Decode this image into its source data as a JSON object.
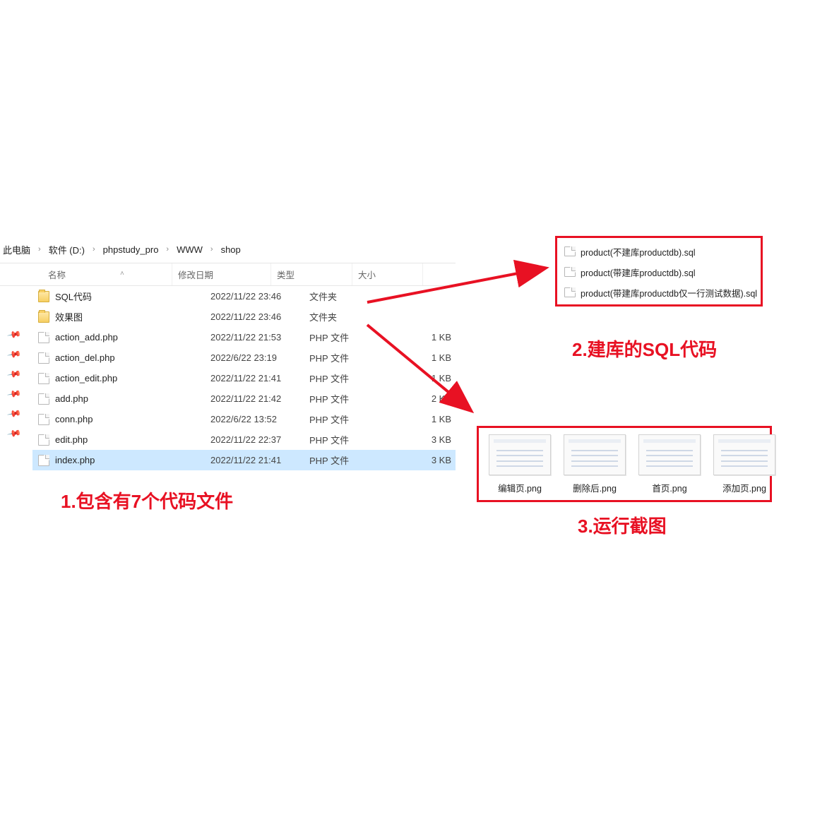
{
  "breadcrumb": {
    "items": [
      "此电脑",
      "软件 (D:)",
      "phpstudy_pro",
      "WWW",
      "shop"
    ]
  },
  "columns": {
    "name": "名称",
    "date": "修改日期",
    "type": "类型",
    "size": "大小"
  },
  "rows": [
    {
      "icon": "folder",
      "name": "SQL代码",
      "date": "2022/11/22 23:46",
      "type": "文件夹",
      "size": "",
      "selected": false
    },
    {
      "icon": "folder",
      "name": "效果图",
      "date": "2022/11/22 23:46",
      "type": "文件夹",
      "size": "",
      "selected": false
    },
    {
      "icon": "file",
      "name": "action_add.php",
      "date": "2022/11/22 21:53",
      "type": "PHP 文件",
      "size": "1 KB",
      "selected": false
    },
    {
      "icon": "file",
      "name": "action_del.php",
      "date": "2022/6/22 23:19",
      "type": "PHP 文件",
      "size": "1 KB",
      "selected": false
    },
    {
      "icon": "file",
      "name": "action_edit.php",
      "date": "2022/11/22 21:41",
      "type": "PHP 文件",
      "size": "1 KB",
      "selected": false
    },
    {
      "icon": "file",
      "name": "add.php",
      "date": "2022/11/22 21:42",
      "type": "PHP 文件",
      "size": "2 KB",
      "selected": false
    },
    {
      "icon": "file",
      "name": "conn.php",
      "date": "2022/6/22 13:52",
      "type": "PHP 文件",
      "size": "1 KB",
      "selected": false
    },
    {
      "icon": "file",
      "name": "edit.php",
      "date": "2022/11/22 22:37",
      "type": "PHP 文件",
      "size": "3 KB",
      "selected": false
    },
    {
      "icon": "file",
      "name": "index.php",
      "date": "2022/11/22 21:41",
      "type": "PHP 文件",
      "size": "3 KB",
      "selected": true
    }
  ],
  "sql_files": [
    "product(不建库productdb).sql",
    "product(带建库productdb).sql",
    "product(带建库productdb仅一行测试数据).sql"
  ],
  "thumbnails": [
    "编辑页.png",
    "删除后.png",
    "首页.png",
    "添加页.png"
  ],
  "annotations": {
    "a1": "1.包含有7个代码文件",
    "a2": "2.建库的SQL代码",
    "a3": "3.运行截图"
  }
}
